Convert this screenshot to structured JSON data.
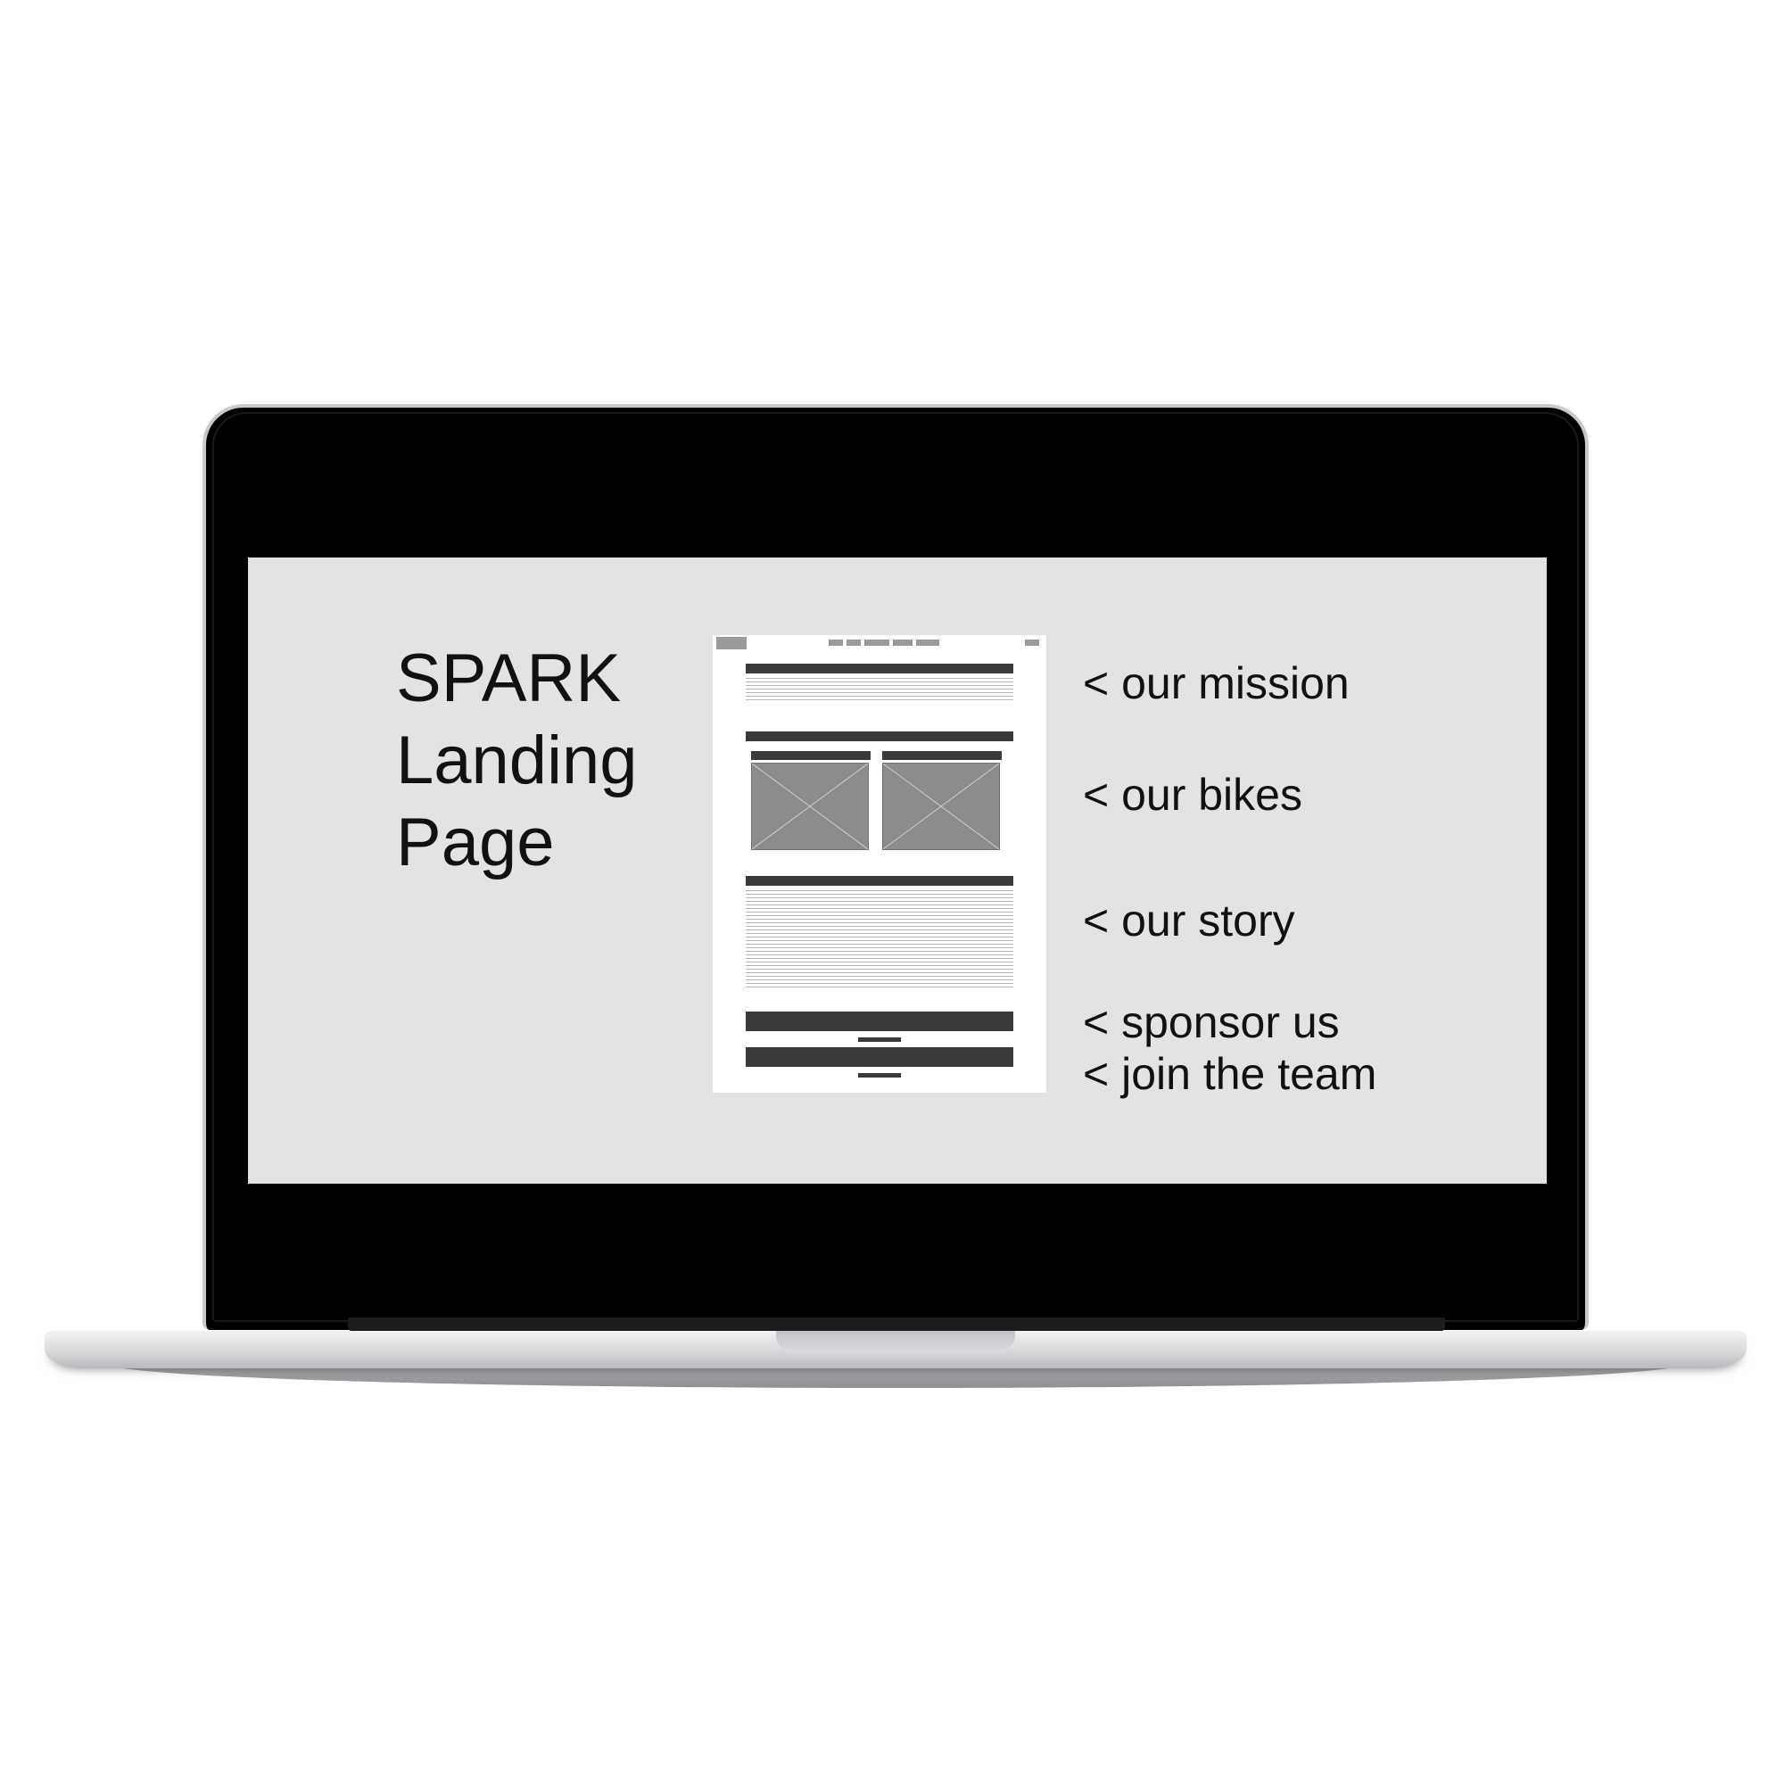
{
  "slide": {
    "title_lines": [
      "SPARK",
      "Landing",
      "Page"
    ],
    "sections": [
      "< our mission",
      "< our bikes",
      "< our story",
      "< sponsor us",
      "< join the team"
    ]
  },
  "colors": {
    "screen_bg": "#e3e3e3",
    "bezel": "#000000",
    "wireframe_dark": "#3a3a3a",
    "wireframe_image": "#8c8c8c"
  }
}
